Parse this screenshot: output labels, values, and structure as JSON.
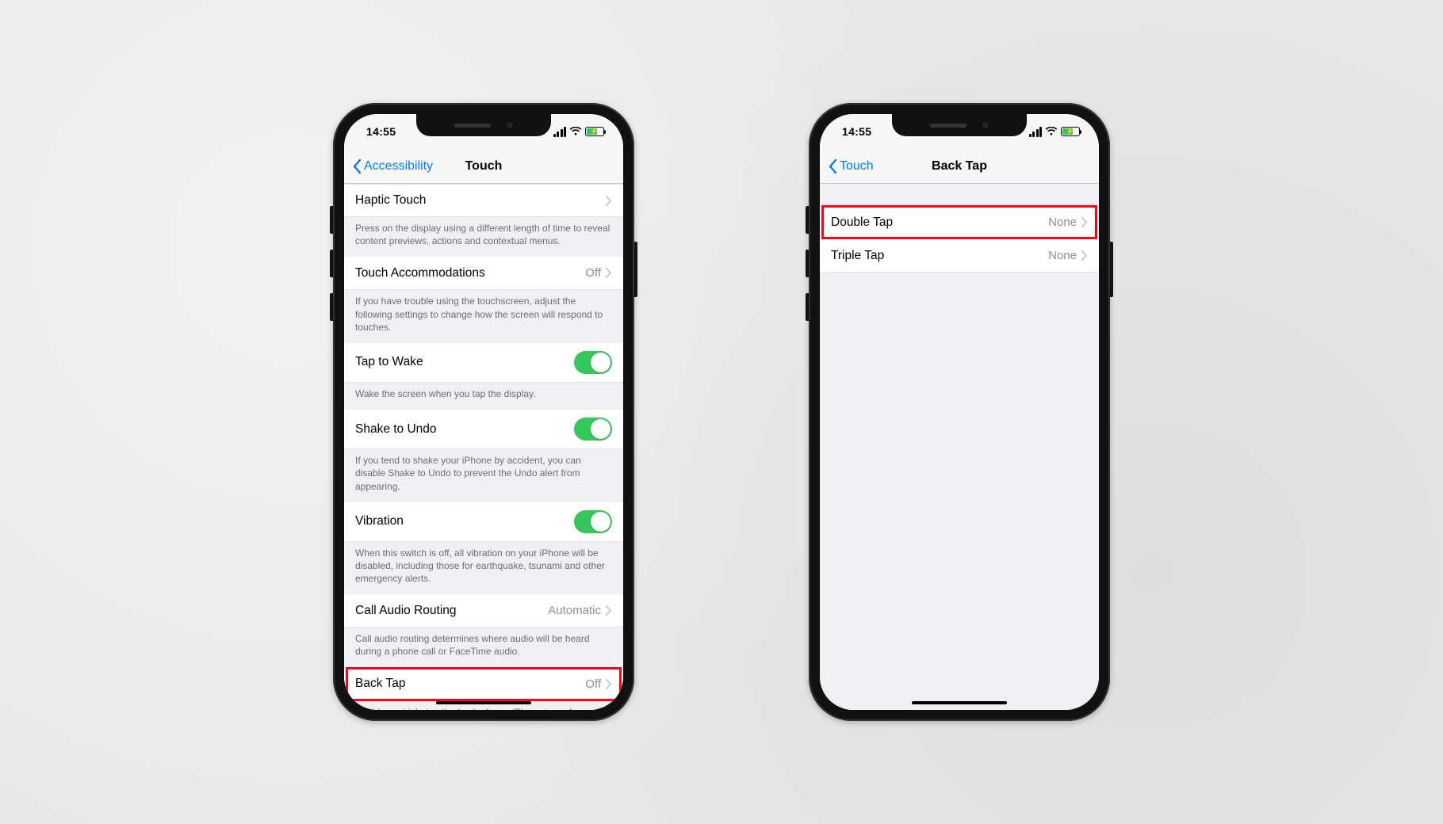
{
  "status": {
    "time": "14:55"
  },
  "phone1": {
    "back_label": "Accessibility",
    "title": "Touch",
    "rows": {
      "haptic_label": "Haptic Touch",
      "haptic_footer": "Press on the display using a different length of time to reveal content previews, actions and contextual menus.",
      "accom_label": "Touch Accommodations",
      "accom_value": "Off",
      "accom_footer": "If you have trouble using the touchscreen, adjust the following settings to change how the screen will respond to touches.",
      "tap_wake_label": "Tap to Wake",
      "tap_wake_footer": "Wake the screen when you tap the display.",
      "shake_label": "Shake to Undo",
      "shake_footer": "If you tend to shake your iPhone by accident, you can disable Shake to Undo to prevent the Undo alert from appearing.",
      "vibration_label": "Vibration",
      "vibration_footer": "When this switch is off, all vibration on your iPhone will be disabled, including those for earthquake, tsunami and other emergency alerts.",
      "call_label": "Call Audio Routing",
      "call_value": "Automatic",
      "call_footer": "Call audio routing determines where audio will be heard during a phone call or FaceTime audio.",
      "backtap_label": "Back Tap",
      "backtap_value": "Off",
      "backtap_footer": "Double- or triple-tap the back of your iPhone to perform actions quickly."
    }
  },
  "phone2": {
    "back_label": "Touch",
    "title": "Back Tap",
    "rows": {
      "double_label": "Double Tap",
      "double_value": "None",
      "triple_label": "Triple Tap",
      "triple_value": "None"
    }
  }
}
